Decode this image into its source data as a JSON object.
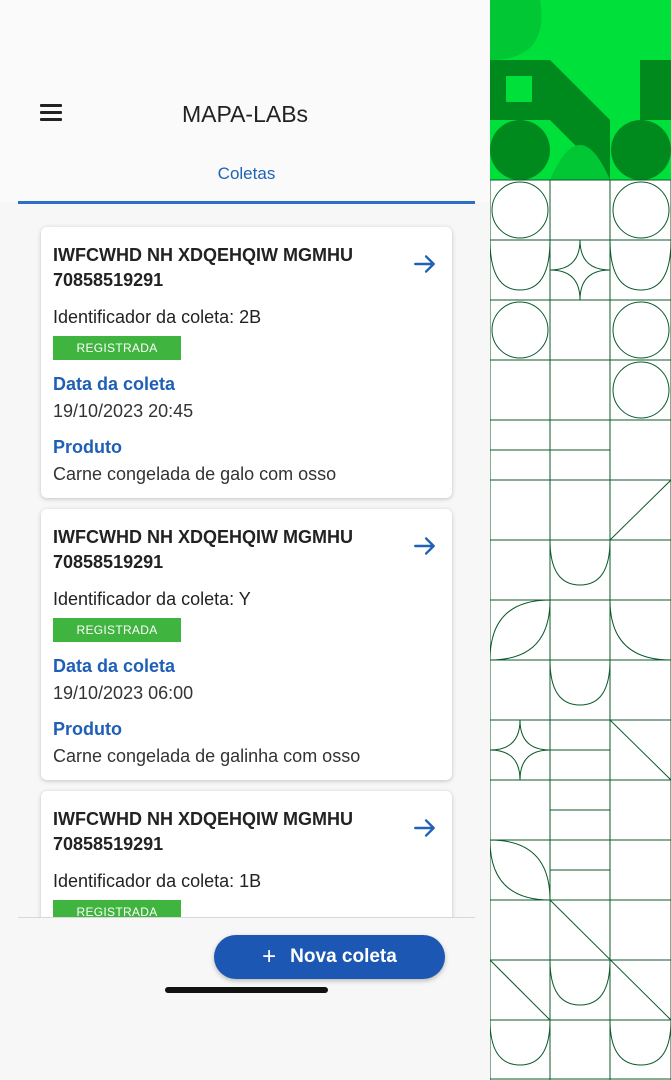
{
  "header": {
    "title": "MAPA-LABs",
    "menu_icon": "hamburger-menu-icon"
  },
  "tabs": [
    {
      "label": "Coletas",
      "active": true
    }
  ],
  "coletas": [
    {
      "name": "IWFCWHD NH XDQEHQIW MGMHU 70858519291",
      "identificador": "Identificador da coleta: 2B",
      "status": "REGISTRADA",
      "data_label": "Data da coleta",
      "data_value": "19/10/2023 20:45",
      "produto_label": "Produto",
      "produto_value": "Carne congelada de galo com osso"
    },
    {
      "name": "IWFCWHD NH XDQEHQIW MGMHU 70858519291",
      "identificador": "Identificador da coleta: Y",
      "status": "REGISTRADA",
      "data_label": "Data da coleta",
      "data_value": "19/10/2023 06:00",
      "produto_label": "Produto",
      "produto_value": "Carne congelada de galinha com osso"
    },
    {
      "name": "IWFCWHD NH XDQEHQIW MGMHU 70858519291",
      "identificador": "Identificador da coleta: 1B",
      "status": "REGISTRADA"
    }
  ],
  "fab": {
    "label": "Nova coleta",
    "icon": "plus-icon"
  },
  "colors": {
    "primary_blue": "#1d57b4",
    "status_green": "#3fb43f",
    "decor_green": "#00e03a",
    "decor_dark_green": "#008a1e",
    "decor_line": "#0c5a2a"
  }
}
